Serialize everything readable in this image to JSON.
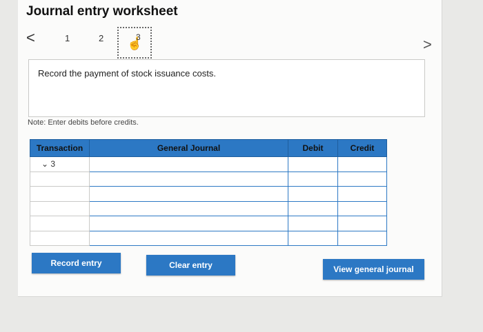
{
  "title": "Journal entry worksheet",
  "nav": {
    "prev_icon": "chevron-left-icon",
    "prev": "<",
    "next": ">",
    "steps": [
      "1",
      "2",
      "3"
    ]
  },
  "instruction": "Record the payment of stock issuance costs.",
  "note": "Note: Enter debits before credits.",
  "table": {
    "headers": [
      "Transaction",
      "General Journal",
      "Debit",
      "Credit"
    ],
    "rows": [
      {
        "transaction": "3",
        "account": "",
        "debit": "",
        "credit": ""
      },
      {
        "transaction": "",
        "account": "",
        "debit": "",
        "credit": ""
      },
      {
        "transaction": "",
        "account": "",
        "debit": "",
        "credit": ""
      },
      {
        "transaction": "",
        "account": "",
        "debit": "",
        "credit": ""
      },
      {
        "transaction": "",
        "account": "",
        "debit": "",
        "credit": ""
      },
      {
        "transaction": "",
        "account": "",
        "debit": "",
        "credit": ""
      }
    ]
  },
  "buttons": {
    "record": "Record entry",
    "clear": "Clear entry",
    "view": "View general journal"
  },
  "colors": {
    "accent": "#2c78c4"
  }
}
